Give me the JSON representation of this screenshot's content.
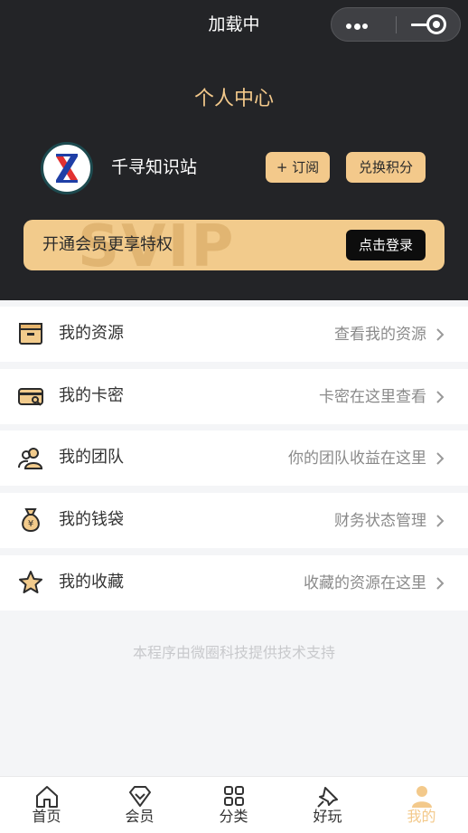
{
  "nav": {
    "title": "加载中"
  },
  "profile": {
    "page_title": "个人中心",
    "username": "千寻知识站",
    "subscribe_label": "+ 订阅",
    "exchange_label": "兑换积分"
  },
  "vip": {
    "watermark": "SVIP",
    "text": "开通会员更享特权",
    "button_label": "点击登录"
  },
  "menu": [
    {
      "label": "我的资源",
      "hint": "查看我的资源",
      "icon": "box-icon"
    },
    {
      "label": "我的卡密",
      "hint": "卡密在这里查看",
      "icon": "card-key-icon"
    },
    {
      "label": "我的团队",
      "hint": "你的团队收益在这里",
      "icon": "team-icon"
    },
    {
      "label": "我的钱袋",
      "hint": "财务状态管理",
      "icon": "money-bag-icon"
    },
    {
      "label": "我的收藏",
      "hint": "收藏的资源在这里",
      "icon": "star-icon"
    }
  ],
  "footer": {
    "note": "本程序由微圈科技提供技术支持"
  },
  "tabs": [
    {
      "label": "首页",
      "icon": "home-icon"
    },
    {
      "label": "会员",
      "icon": "diamond-icon"
    },
    {
      "label": "分类",
      "icon": "grid-icon"
    },
    {
      "label": "好玩",
      "icon": "pin-icon"
    },
    {
      "label": "我的",
      "icon": "user-icon",
      "active": true
    }
  ],
  "colors": {
    "header_bg": "#232427",
    "accent_gold": "#f3c98b",
    "vip_card": "#f2cb8c",
    "icon_fill": "#f2cb8c",
    "icon_stroke": "#2a2a2a"
  }
}
